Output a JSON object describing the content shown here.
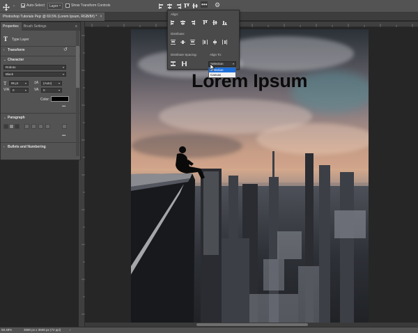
{
  "optionsBar": {
    "autoSelectLabel": "Auto-Select",
    "layerSelect": "Layer",
    "showTransformLabel": "Show Transform Controls",
    "moreGlyph": "•••",
    "gearGlyph": "⚙"
  },
  "docTab": {
    "title": "Photoshop Tutorials Pejz @ 69.5% (Lorem Ipsum, RGB/8#) *",
    "close": "×"
  },
  "panel": {
    "tabs": [
      "Properties",
      "Brush Settings"
    ],
    "menuGlyph": "≡",
    "layerType": "Type Layer",
    "transformLabel": "Transform",
    "characterLabel": "Character",
    "fontFamily": "Roboto",
    "fontStyle": "Black",
    "fontSize": "95 pt",
    "leading": "(Auto)",
    "tracking": "0",
    "kerning": "0",
    "colorLabel": "Color:",
    "colorSwatch": "#000000",
    "paragraphLabel": "Paragraph",
    "bulletsLabel": "Bullets and Numbering",
    "moreGlyph": "•••"
  },
  "canvas": {
    "text": "Lorem Ipsum"
  },
  "alignPopup": {
    "alignLabel": "Align:",
    "distributeLabel": "Distribute:",
    "distributeSpacingLabel": "Distribute Spacing:",
    "alignToLabel": "Align To:",
    "alignToValue": "Selection",
    "options": [
      "Selection",
      "Canvas"
    ]
  },
  "status": {
    "zoom": "69.48%",
    "docInfo": "3080 px x 3508 px (72 ppi)"
  }
}
